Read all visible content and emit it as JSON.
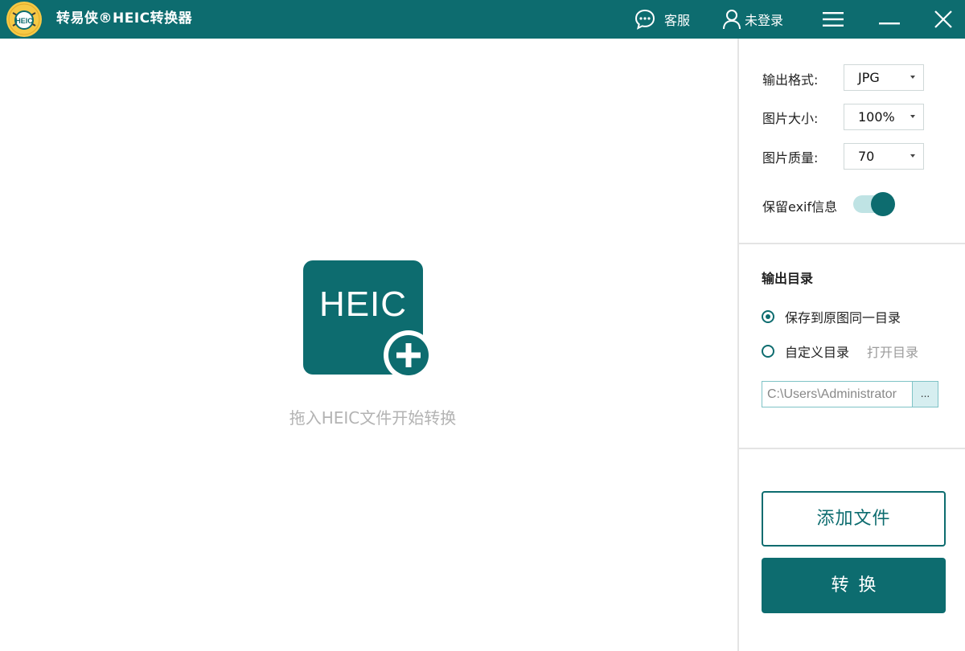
{
  "app": {
    "title": "转易侠®HEIC转换器",
    "logo_text": "HEIC",
    "accent_color": "#0d6c6f"
  },
  "titlebar": {
    "support_label": "客服",
    "support_icon": "chat-bubble-icon",
    "login_label": "未登录",
    "login_icon": "user-icon",
    "menu_icon": "hamburger-menu-icon",
    "minimize_icon": "minimize-icon",
    "close_icon": "close-icon"
  },
  "drop_area": {
    "tile_text": "HEIC",
    "tile_icon": "plus-circle-icon",
    "hint": "拖入HEIC文件开始转换"
  },
  "settings": {
    "output_format_label": "输出格式:",
    "output_format_value": "JPG",
    "image_size_label": "图片大小:",
    "image_size_value": "100%",
    "image_quality_label": "图片质量:",
    "image_quality_value": "70",
    "keep_exif_label": "保留exif信息",
    "keep_exif_enabled": true
  },
  "output_dir": {
    "title": "输出目录",
    "option_same": "保存到原图同一目录",
    "option_same_selected": true,
    "option_custom": "自定义目录",
    "option_custom_selected": false,
    "open_dir_label": "打开目录",
    "path_value": "C:\\Users\\Administrator",
    "browse_label": "..."
  },
  "actions": {
    "add_files_label": "添加文件",
    "convert_label": "转换"
  }
}
